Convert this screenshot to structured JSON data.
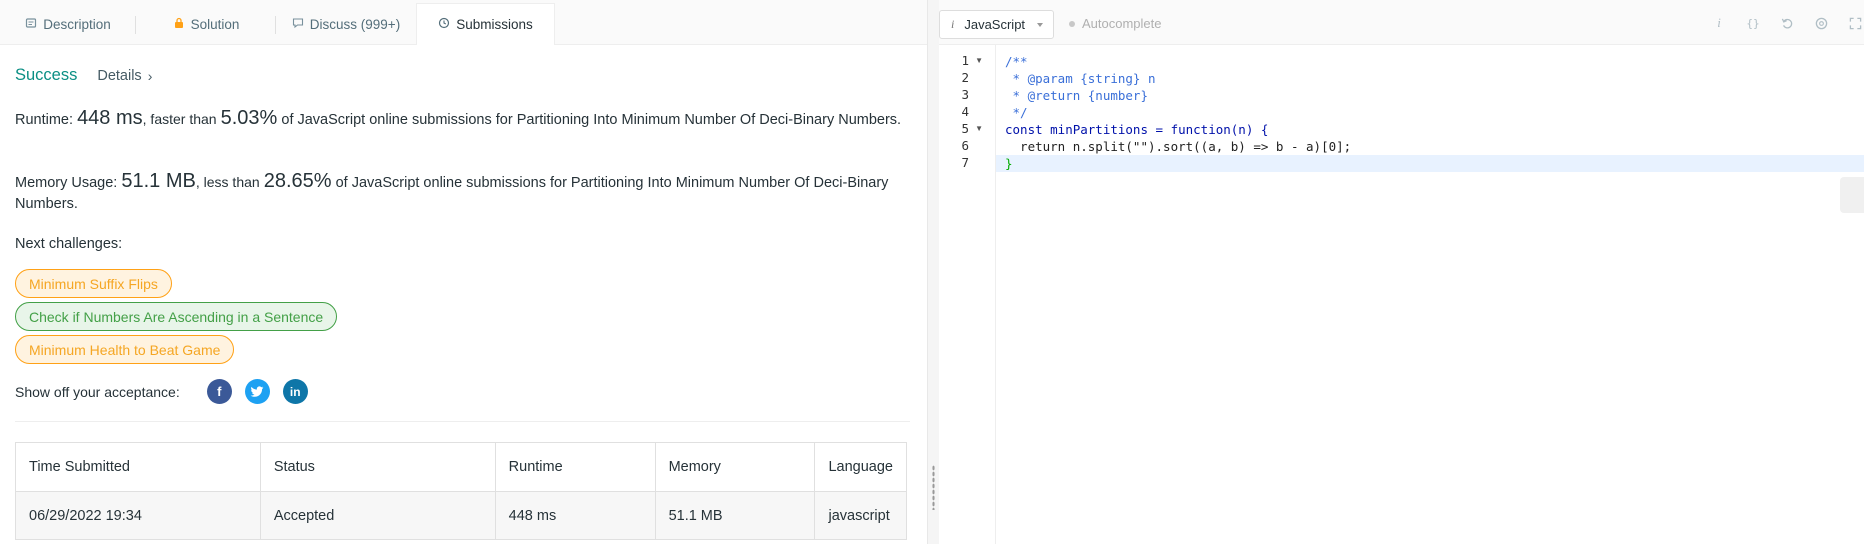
{
  "tabs": [
    {
      "label": "Description",
      "icon": "description-icon"
    },
    {
      "label": "Solution",
      "icon": "lock-icon"
    },
    {
      "label": "Discuss (999+)",
      "icon": "discuss-icon"
    },
    {
      "label": "Submissions",
      "icon": "clock-icon",
      "active": true
    }
  ],
  "result": {
    "status": "Success",
    "details_label": "Details",
    "runtime_label": "Runtime:",
    "runtime_value": "448 ms",
    "runtime_mid": ", faster than",
    "runtime_pct": "5.03%",
    "runtime_tail": "of JavaScript online submissions for Partitioning Into Minimum Number Of Deci-Binary Numbers.",
    "memory_label": "Memory Usage:",
    "memory_value": "51.1 MB",
    "memory_mid": ", less than",
    "memory_pct": "28.65%",
    "memory_tail": "of JavaScript online submissions for Partitioning Into Minimum Number Of Deci-Binary Numbers."
  },
  "next_challenges": {
    "label": "Next challenges:",
    "items": [
      {
        "title": "Minimum Suffix Flips",
        "difficulty": "medium"
      },
      {
        "title": "Check if Numbers Are Ascending in a Sentence",
        "difficulty": "easy"
      },
      {
        "title": "Minimum Health to Beat Game",
        "difficulty": "medium"
      }
    ]
  },
  "share": {
    "label": "Show off your acceptance:",
    "icons": [
      "facebook-icon",
      "twitter-icon",
      "linkedin-icon"
    ]
  },
  "submissions_table": {
    "headers": [
      "Time Submitted",
      "Status",
      "Runtime",
      "Memory",
      "Language"
    ],
    "rows": [
      [
        "06/29/2022 19:34",
        "Accepted",
        "448 ms",
        "51.1 MB",
        "javascript"
      ]
    ]
  },
  "editor": {
    "language": "JavaScript",
    "autocomplete_label": "Autocomplete",
    "line_numbers": [
      "1",
      "2",
      "3",
      "4",
      "5",
      "6",
      "7"
    ],
    "code_lines": [
      "/**",
      " * @param {string} n",
      " * @return {number}",
      " */",
      "const minPartitions = function(n) {",
      "  return n.split(\"\").sort((a, b) => b - a)[0];",
      "}"
    ]
  },
  "colors": {
    "accent_green": "#0b8f84",
    "medium": "#ffa116",
    "easy": "#43a047",
    "facebook": "#3b5998",
    "twitter": "#1da1f2",
    "linkedin": "#0e76a8"
  }
}
